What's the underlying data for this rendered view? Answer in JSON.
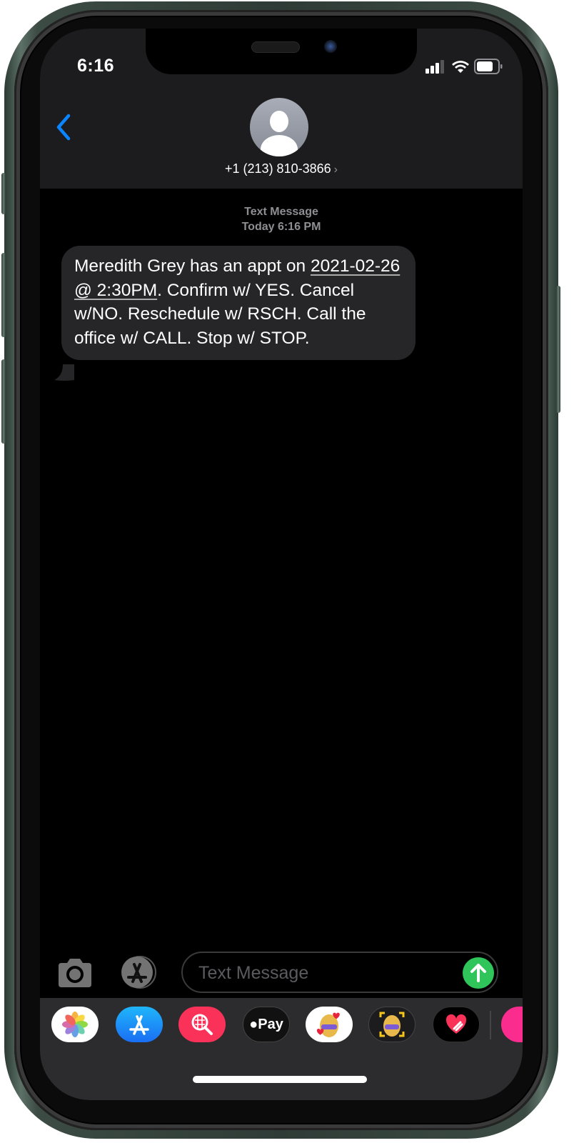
{
  "status_bar": {
    "time": "6:16",
    "signal_icon": "cellular-signal-icon",
    "wifi_icon": "wifi-icon",
    "battery_icon": "battery-icon"
  },
  "header": {
    "back_icon": "chevron-left-icon",
    "avatar_icon": "person-avatar-icon",
    "contact": "+1 (213) 810-3866",
    "contact_chevron": "›"
  },
  "conversation": {
    "service": "Text Message",
    "timestamp": "Today 6:16 PM",
    "messages": [
      {
        "direction": "incoming",
        "text_before": "Meredith Grey has an appt on ",
        "link": "2021-02-26 @ 2:30PM",
        "text_after": ". Confirm w/ YES. Cancel w/NO. Reschedule w/ RSCH. Call the office w/ CALL. Stop w/ STOP."
      }
    ]
  },
  "composer": {
    "camera_icon": "camera-icon",
    "apps_icon": "app-store-icon",
    "placeholder": "Text Message",
    "value": "",
    "send_icon": "arrow-up-icon",
    "send_color": "#30c55a"
  },
  "app_drawer": {
    "apps": [
      {
        "name": "Photos",
        "icon": "photos-icon"
      },
      {
        "name": "App Store",
        "icon": "app-store-icon"
      },
      {
        "name": "Images Search",
        "icon": "globe-search-icon"
      },
      {
        "name": "Apple Pay",
        "icon": "apple-pay-icon",
        "label": "Pay"
      },
      {
        "name": "Memoji Stickers",
        "icon": "memoji-stickers-icon"
      },
      {
        "name": "Animoji",
        "icon": "animoji-icon"
      },
      {
        "name": "Digital Touch",
        "icon": "digital-touch-heart-icon"
      },
      {
        "name": "Music",
        "icon": "music-icon"
      }
    ]
  },
  "colors": {
    "accent": "#0a84ff",
    "bubble": "#262628",
    "header": "#1c1c1e",
    "drawer": "#2c2c2e"
  }
}
